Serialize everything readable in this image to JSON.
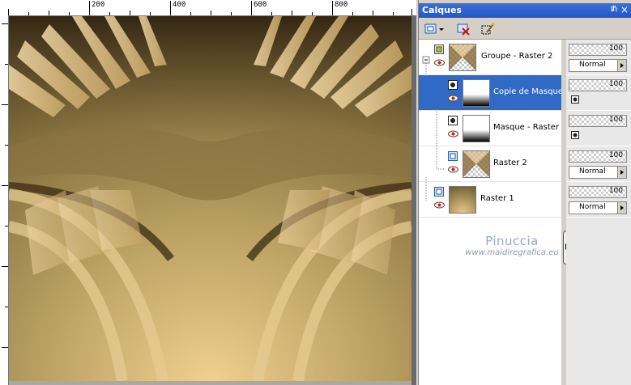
{
  "ruler": {
    "labels": [
      "200",
      "400",
      "600",
      "800"
    ]
  },
  "palette": {
    "title": "Calques",
    "pin_glyph": "ᵺ",
    "close_glyph": "×",
    "layers": [
      {
        "name": "Groupe - Raster 2",
        "opacity": "100",
        "blend": "Normal",
        "selected": false
      },
      {
        "name": "Copie de Masque -",
        "opacity": "100",
        "blend": "",
        "selected": true
      },
      {
        "name": "Masque - Raster 2",
        "opacity": "100",
        "blend": "",
        "selected": false
      },
      {
        "name": "Raster 2",
        "opacity": "100",
        "blend": "Normal",
        "selected": false
      },
      {
        "name": "Raster 1",
        "opacity": "100",
        "blend": "Normal",
        "selected": false
      }
    ]
  },
  "watermark": {
    "line1": "Pinuccia",
    "line2": "www.maidiregrafica.eu"
  },
  "colors": {
    "accent": "#316ac5",
    "title_bar": "#2457c7",
    "art_light": "#e8c98a",
    "art_dark": "#3a2a10"
  },
  "icons": [
    "new-layer-icon",
    "delete-layer-icon",
    "mask-wand-icon",
    "eye-icon",
    "mask-icon"
  ]
}
